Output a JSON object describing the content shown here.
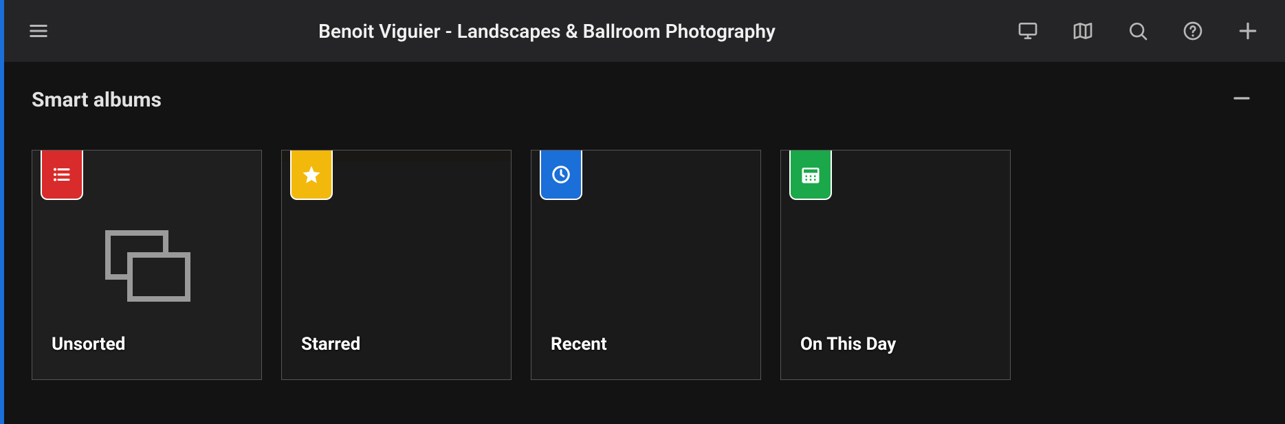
{
  "header": {
    "title": "Benoit Viguier - Landscapes & Ballroom Photography"
  },
  "section": {
    "title": "Smart albums"
  },
  "albums": [
    {
      "label": "Unsorted",
      "badge_color": "#d92b2b",
      "badge_icon": "list"
    },
    {
      "label": "Starred",
      "badge_color": "#f2b90c",
      "badge_icon": "star"
    },
    {
      "label": "Recent",
      "badge_color": "#1a6fd8",
      "badge_icon": "clock"
    },
    {
      "label": "On This Day",
      "badge_color": "#1aa84a",
      "badge_icon": "calendar"
    }
  ]
}
